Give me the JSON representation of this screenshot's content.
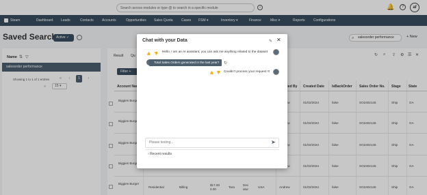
{
  "header": {
    "search_placeholder": "Search across modules or type @ to search in a specific module",
    "info_icon": "info-icon",
    "user_initials": "af"
  },
  "nav": {
    "items": [
      "Steam",
      "Dashboard",
      "Leads",
      "Contacts",
      "Accounts",
      "Opportunities",
      "Sales Quota",
      "Cases",
      "FSM",
      "Inventory",
      "Finance",
      "Misc",
      "Reports",
      "Configurations"
    ]
  },
  "page": {
    "title": "Saved Search",
    "status_label": "Active",
    "search_value": "salesorder performance",
    "new_label": "+ New"
  },
  "left": {
    "name_label": "Name",
    "item_label": "salesorder performance",
    "showing_text": "Showing 1 to 1 of 1 entries",
    "pagination": [
      "«",
      "‹",
      "1",
      "›",
      "»"
    ],
    "page_size": "15"
  },
  "main": {
    "tabs": [
      "Result",
      "Qu"
    ],
    "filter_label": "Filter +",
    "columns": [
      "Account Nam",
      "",
      "",
      "",
      "",
      "",
      "Created By",
      "Created Date",
      "IsBackOrder",
      "Sales Order No.",
      "Stage",
      "State"
    ],
    "rows": [
      {
        "account": "Biggies Burger",
        "created_by": "Andrew",
        "created_date": "01/02/2024",
        "backorder": "false",
        "so_no": "SO2402145",
        "stage": "Ship",
        "state": "GA"
      },
      {
        "account": "Biggies Burger",
        "created_by": "Andrew",
        "created_date": "01/02/2024",
        "backorder": "false",
        "so_no": "SO2402145",
        "stage": "Ship",
        "state": "GA"
      },
      {
        "account": "Biggies Burger",
        "created_by": "Andrew",
        "created_date": "01/02/2024",
        "backorder": "false",
        "so_no": "SO2402145",
        "stage": "Ship",
        "state": "GA"
      },
      {
        "account": "Biggies Burger",
        "created_by": "Andrew",
        "created_date": "01/02/2024",
        "backorder": "false",
        "so_no": "SO2402145",
        "stage": "Ship",
        "state": "GA"
      },
      {
        "account": "Biggies Burger",
        "type": "Residential",
        "billing": "Billing",
        "amount": "$17.60 0.00",
        "person": "Tara",
        "city": "Dec atur",
        "country": "USA",
        "created_by": "Andrew",
        "created_date": "01/02/2024",
        "backorder": "false",
        "so_no": "SO2402145",
        "stage": "Ship",
        "state": "GA"
      }
    ]
  },
  "chat": {
    "title": "Chat with your Data",
    "bot_greeting": "Hello, I am an AI assistant, you can ask me anything related to the dataset",
    "user_question": "Total Sales Orders generated in the last year?",
    "bot_reply": "Couldn't process your request !!!",
    "input_placeholder": "Please testing...",
    "recent_label": "Recent results"
  },
  "colors": {
    "nav_bg": "#3a4e5f",
    "accent": "#4c5f6f"
  }
}
